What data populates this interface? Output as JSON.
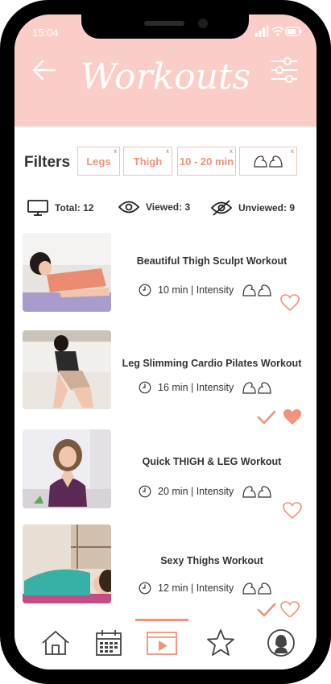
{
  "status": {
    "time": "15:04"
  },
  "header": {
    "title": "Workouts"
  },
  "filters": {
    "label": "Filters",
    "chips": [
      "Legs",
      "Thigh",
      "10 - 20 min"
    ],
    "remove_symbol": "x"
  },
  "stats": {
    "total": "Total: 12",
    "viewed": "Viewed: 3",
    "unviewed": "Unviewed: 9"
  },
  "workouts": [
    {
      "title": "Beautiful Thigh Sculpt Workout",
      "meta": "10 min | Intensity",
      "viewed": false,
      "favorite": false
    },
    {
      "title": "Leg Slimming Cardio Pilates Workout",
      "meta": "16 min | Intensity",
      "viewed": true,
      "favorite": true
    },
    {
      "title": "Quick THIGH & LEG Workout",
      "meta": "20 min | Intensity",
      "viewed": false,
      "favorite": false
    },
    {
      "title": "Sexy Thighs Workout",
      "meta": "12 min | Intensity",
      "viewed": true,
      "favorite": false
    }
  ],
  "nav": {
    "items": [
      "home-icon",
      "calendar-icon",
      "video-icon",
      "star-icon",
      "profile-icon"
    ],
    "active": "video-icon"
  },
  "colors": {
    "accent": "#f2927a",
    "header_bg": "#fbcdc9"
  }
}
